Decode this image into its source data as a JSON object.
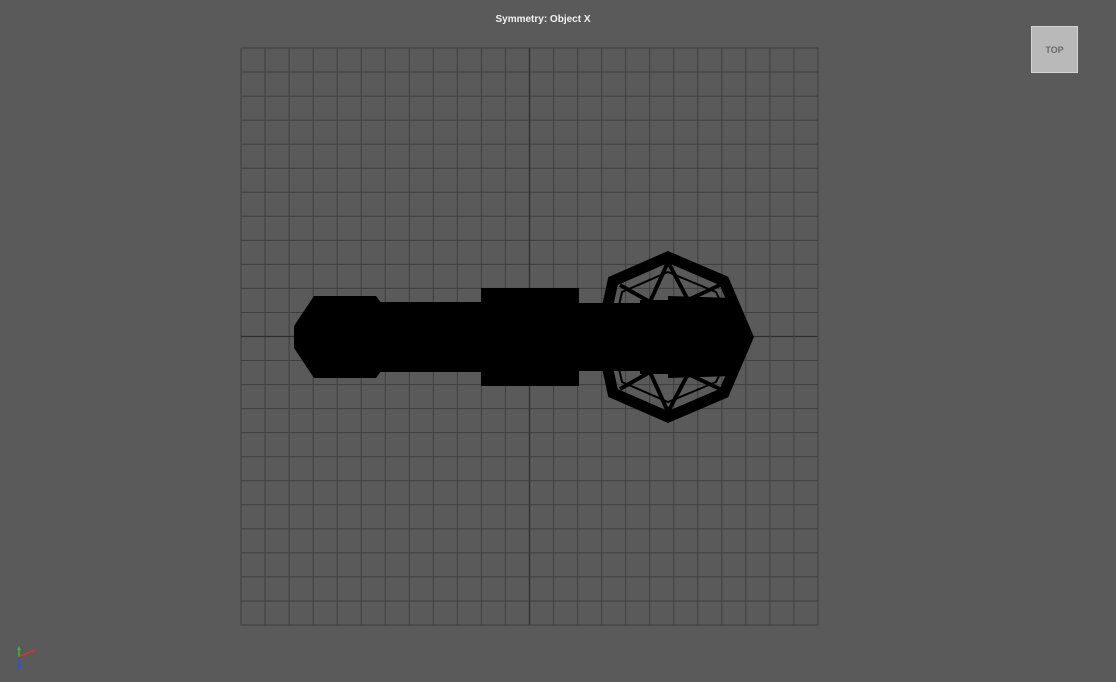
{
  "viewport": {
    "symmetry_label": "Symmetry: Object X",
    "view_cube_label": "TOP"
  },
  "grid": {
    "show": true,
    "divisions": 24
  },
  "axis_gizmo": {
    "axes": [
      "x",
      "y",
      "z"
    ],
    "colors": {
      "x": "#e03030",
      "y": "#30c030",
      "z": "#3050e0"
    }
  },
  "colors": {
    "background": "#5a5a5a",
    "grid_line": "#3f3f3f",
    "grid_axis": "#2e2e2e",
    "model": "#000000"
  }
}
